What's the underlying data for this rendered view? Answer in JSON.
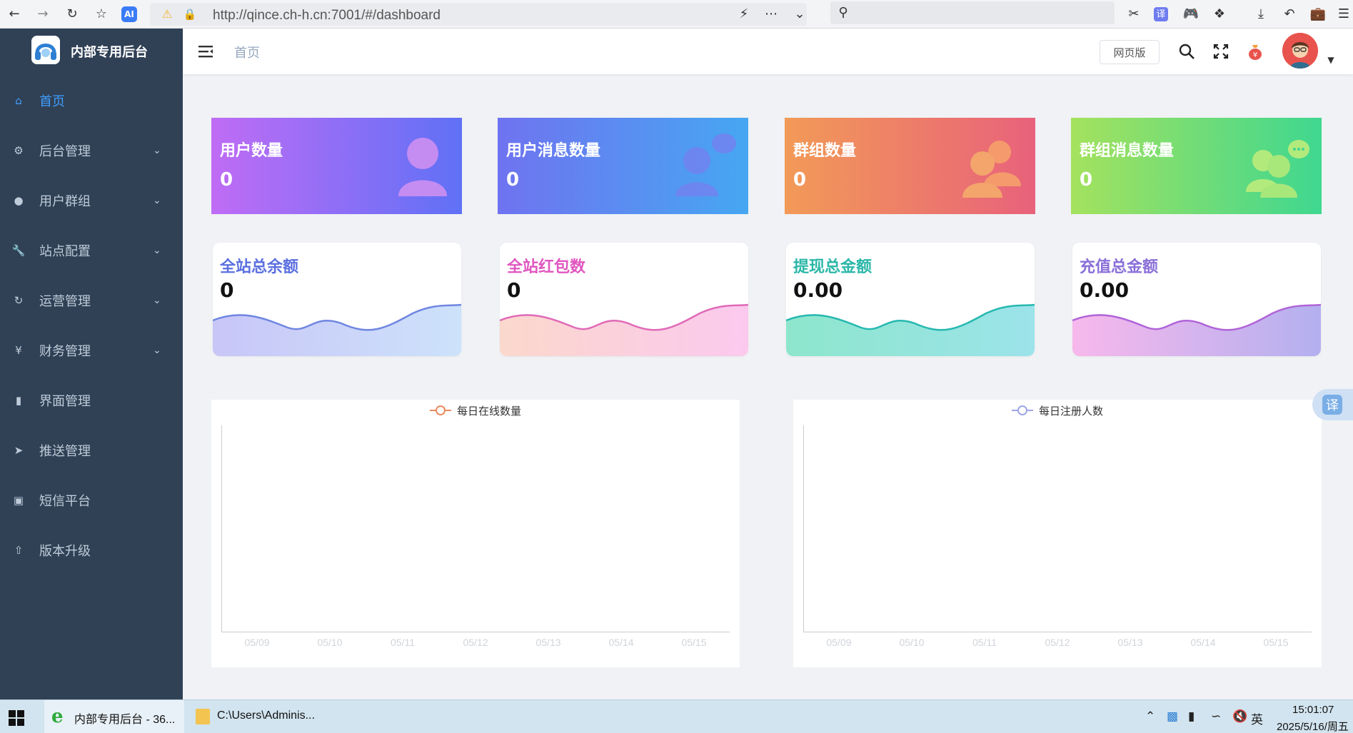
{
  "browser": {
    "url": "http://qince.ch-h.cn:7001/#/dashboard",
    "search_placeholder": ""
  },
  "sidebar": {
    "title": "内部专用后台",
    "items": [
      {
        "label": "首页",
        "icon": "home-icon",
        "active": true
      },
      {
        "label": "后台管理",
        "icon": "gear-icon",
        "chevron": true
      },
      {
        "label": "用户群组",
        "icon": "user-icon",
        "chevron": true
      },
      {
        "label": "站点配置",
        "icon": "wrench-icon",
        "chevron": true
      },
      {
        "label": "运营管理",
        "icon": "refresh-icon",
        "chevron": true
      },
      {
        "label": "财务管理",
        "icon": "money-icon",
        "chevron": true
      },
      {
        "label": "界面管理",
        "icon": "shirt-icon"
      },
      {
        "label": "推送管理",
        "icon": "send-icon"
      },
      {
        "label": "短信平台",
        "icon": "chat-icon"
      },
      {
        "label": "版本升级",
        "icon": "upgrade-icon"
      }
    ]
  },
  "header": {
    "breadcrumb": "首页",
    "web_button": "网页版"
  },
  "stat_cards": [
    {
      "title": "用户数量",
      "value": "0"
    },
    {
      "title": "用户消息数量",
      "value": "0"
    },
    {
      "title": "群组数量",
      "value": "0"
    },
    {
      "title": "群组消息数量",
      "value": "0"
    }
  ],
  "wave_cards": [
    {
      "title": "全站总余额",
      "value": "0",
      "color": "#5b6fe0"
    },
    {
      "title": "全站红包数",
      "value": "0",
      "color": "#e056c0"
    },
    {
      "title": "提现总金额",
      "value": "0.00",
      "color": "#2bb7a8"
    },
    {
      "title": "充值总金额",
      "value": "0.00",
      "color": "#8a6fd8"
    }
  ],
  "charts": [
    {
      "legend": "每日在线数量",
      "legend_color": "#e98a5f",
      "x": [
        "05/09",
        "05/10",
        "05/11",
        "05/12",
        "05/13",
        "05/14",
        "05/15"
      ]
    },
    {
      "legend": "每日注册人数",
      "legend_color": "#9ca6e8",
      "x": [
        "05/09",
        "05/10",
        "05/11",
        "05/12",
        "05/13",
        "05/14",
        "05/15"
      ]
    }
  ],
  "translate": "译",
  "taskbar": {
    "ie_label": "内部专用后台 - 36...",
    "explorer_label": "C:\\Users\\Adminis...",
    "ime": "英",
    "time": "15:01:07",
    "date": "2025/5/16/周五"
  }
}
